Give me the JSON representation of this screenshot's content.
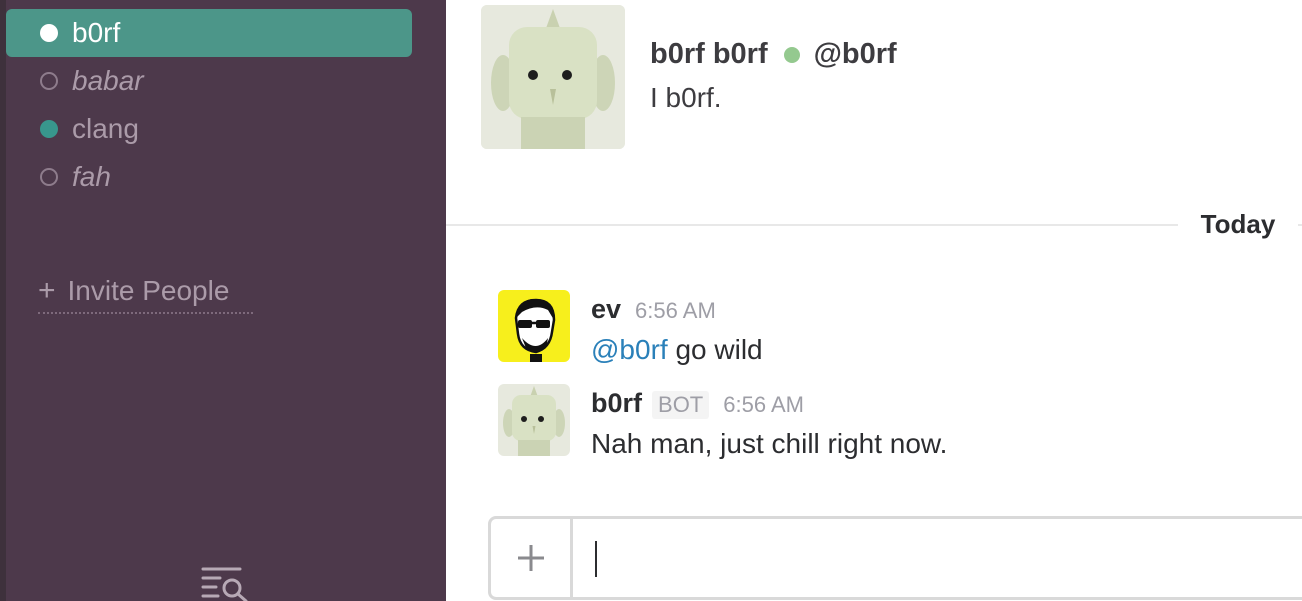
{
  "sidebar": {
    "direct_messages": [
      {
        "name": "b0rf",
        "presence": "online",
        "active": true
      },
      {
        "name": "babar",
        "presence": "away",
        "active": false
      },
      {
        "name": "clang",
        "presence": "online",
        "active": false
      },
      {
        "name": "fah",
        "presence": "away",
        "active": false
      }
    ],
    "invite_label": "Invite People",
    "invite_icon": "plus-icon",
    "filter_icon": "quick-switcher-icon"
  },
  "profile": {
    "display_name": "b0rf b0rf",
    "handle": "@b0rf",
    "status": "online",
    "bio": "I b0rf."
  },
  "divider": {
    "label": "Today"
  },
  "messages": [
    {
      "author": "ev",
      "badge": "",
      "time": "6:56 AM",
      "mention": "@b0rf",
      "text": " go wild"
    },
    {
      "author": "b0rf",
      "badge": "BOT",
      "time": "6:56 AM",
      "mention": "",
      "text": "Nah man, just chill right now."
    }
  ],
  "composer": {
    "value": "",
    "add_icon": "plus-icon"
  },
  "colors": {
    "sidebar_bg": "#4d394b",
    "active_item": "#4c9689",
    "online": "#38978d",
    "mention": "#2a80b9"
  }
}
